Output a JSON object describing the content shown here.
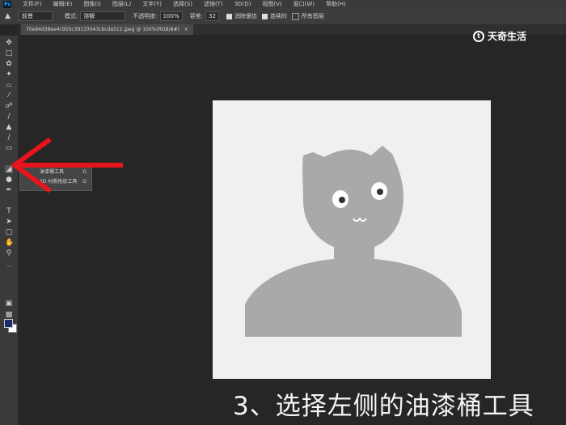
{
  "menubar": {
    "logo": "Ps",
    "items": [
      "文件(F)",
      "编辑(E)",
      "图像(I)",
      "图层(L)",
      "文字(Y)",
      "选择(S)",
      "滤镜(T)",
      "3D(D)",
      "视图(V)",
      "窗口(W)",
      "帮助(H)"
    ]
  },
  "options": {
    "fill_source": "前景",
    "mode_label": "模式:",
    "mode_value": "溶解",
    "opacity_label": "不透明度:",
    "opacity_value": "100%",
    "tolerance_label": "容差:",
    "tolerance_value": "32",
    "antialias_label": "消除锯齿",
    "contiguous_label": "连续的",
    "all_layers_label": "所有图层"
  },
  "document_tab": {
    "title": "70e84d38ee4c955c39133043cbcda512.jpeg @ 100%(RGB/8#)",
    "close": "×"
  },
  "flyout": {
    "items": [
      {
        "label": "油漆桶工具",
        "shortcut": "G"
      },
      {
        "label": "3D 材质拖放工具",
        "shortcut": "G"
      }
    ]
  },
  "watermark": {
    "text": "天奇生活"
  },
  "caption": {
    "text": "3、选择左侧的油漆桶工具"
  },
  "colors": {
    "foreground": "#1a2a6c",
    "background": "#ffffff",
    "arrow": "#e8141c",
    "figure": "#a9aaa7"
  }
}
